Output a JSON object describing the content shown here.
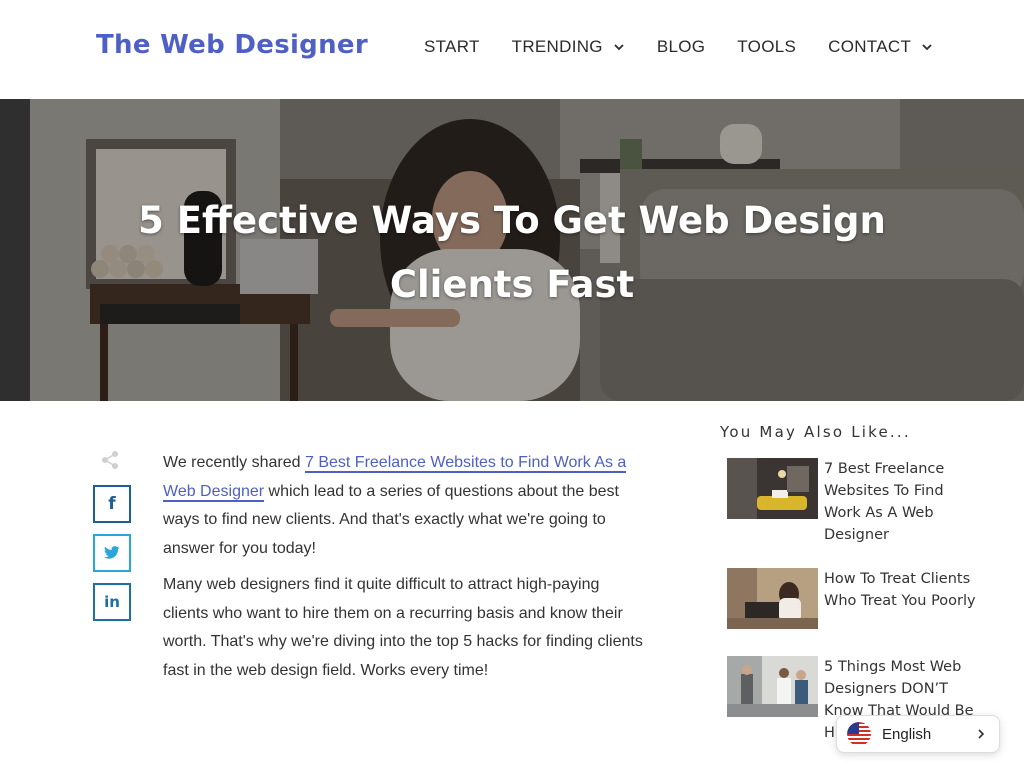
{
  "header": {
    "logo": "The Web Designer",
    "nav": [
      {
        "label": "START",
        "has_dropdown": false
      },
      {
        "label": "TRENDING",
        "has_dropdown": true
      },
      {
        "label": "BLOG",
        "has_dropdown": false
      },
      {
        "label": "TOOLS",
        "has_dropdown": false
      },
      {
        "label": "CONTACT",
        "has_dropdown": true
      }
    ]
  },
  "hero": {
    "title_line1": "5 Effective Ways To Get Web Design",
    "title_line2": "Clients Fast"
  },
  "share": {
    "icons": [
      "share-icon",
      "facebook-icon",
      "twitter-icon",
      "linkedin-icon"
    ]
  },
  "article": {
    "p1_prefix": "We recently shared ",
    "p1_link": "7 Best Freelance Websites to Find Work As a Web Designer",
    "p1_suffix": " which lead to a series of questions about the best ways to find new clients. And that's exactly what we're going to answer for you today!",
    "p2": "Many web designers find it quite difficult to attract high-paying clients who want to hire them on a recurring basis and know their worth. That's why we're diving into the top 5 hacks for finding clients fast in the web design field. Works every time!"
  },
  "sidebar": {
    "title": "You May Also Like...",
    "items": [
      {
        "title": "7 Best Freelance Websites To Find Work As A Web Designer"
      },
      {
        "title": "How To Treat Clients Who Treat You Poorly"
      },
      {
        "title": "5 Things Most Web Designers DON’T Know That Would Be H"
      }
    ]
  },
  "language": {
    "label": "English"
  },
  "colors": {
    "brand": "#4e5fc6",
    "facebook": "#1d5e96",
    "twitter": "#2aa5d8",
    "linkedin": "#1d6fa5"
  }
}
